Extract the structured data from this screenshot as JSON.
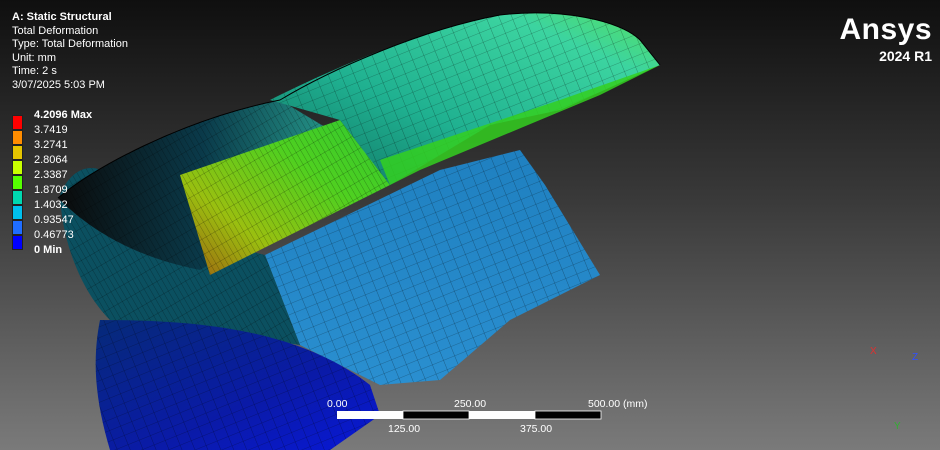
{
  "info": {
    "title": "A: Static Structural",
    "result": "Total Deformation",
    "type": "Type: Total Deformation",
    "unit": "Unit: mm",
    "time": "Time: 2 s",
    "timestamp": "3/07/2025 5:03 PM"
  },
  "brand": {
    "name": "Ansys",
    "version": "2024 R1"
  },
  "legend": {
    "bands": [
      {
        "color": "#ff0000"
      },
      {
        "color": "#ff8c00"
      },
      {
        "color": "#e5c500"
      },
      {
        "color": "#c8ff00"
      },
      {
        "color": "#55ff00"
      },
      {
        "color": "#00d8b0"
      },
      {
        "color": "#00c0ee"
      },
      {
        "color": "#1f6dff"
      },
      {
        "color": "#0000ff"
      }
    ],
    "labels": [
      "4.2096 Max",
      "3.7419",
      "3.2741",
      "2.8064",
      "2.3387",
      "1.8709",
      "1.4032",
      "0.93547",
      "0.46773",
      "0 Min"
    ]
  },
  "scale": {
    "top_labels": [
      "0.00",
      "250.00",
      "500.00 (mm)"
    ],
    "bottom_labels": [
      "125.00",
      "375.00"
    ]
  },
  "triad": {
    "x": "X",
    "y": "Y",
    "z": "Z",
    "x_color": "#e03030",
    "y_color": "#30b030",
    "z_color": "#3050ff"
  }
}
